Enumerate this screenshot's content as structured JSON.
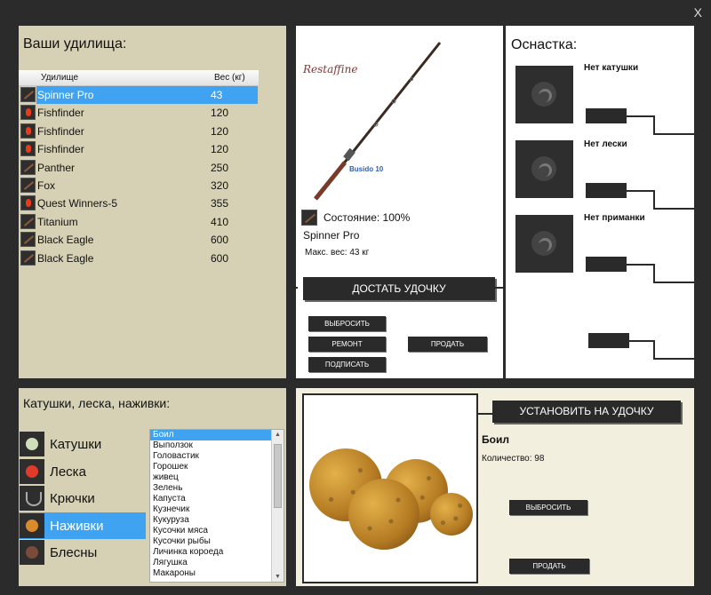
{
  "window": {
    "close_label": "X"
  },
  "rods": {
    "title": "Ваши удилища:",
    "columns": {
      "name": "Удилище",
      "weight": "Вес (кг)"
    },
    "items": [
      {
        "name": "Spinner Pro",
        "weight": "43",
        "icon": "rod-icon",
        "selected": true
      },
      {
        "name": "Fishfinder",
        "weight": "120",
        "icon": "float-icon"
      },
      {
        "name": "Fishfinder",
        "weight": "120",
        "icon": "float-icon"
      },
      {
        "name": "Fishfinder",
        "weight": "120",
        "icon": "float-icon"
      },
      {
        "name": "Panther",
        "weight": "250",
        "icon": "rod-icon"
      },
      {
        "name": "Fox",
        "weight": "320",
        "icon": "rod-icon"
      },
      {
        "name": "Quest Winners-5",
        "weight": "355",
        "icon": "float-icon"
      },
      {
        "name": "Titanium",
        "weight": "410",
        "icon": "rod-icon"
      },
      {
        "name": "Black Eagle",
        "weight": "600",
        "icon": "rod-icon"
      },
      {
        "name": "Black Eagle",
        "weight": "600",
        "icon": "rod-icon"
      }
    ]
  },
  "rod_detail": {
    "brand_logo": "Restaffine",
    "model_label": "Busido 10",
    "state": "Состояние: 100%",
    "name": "Spinner Pro",
    "max_weight": "Макс. вес: 43 кг",
    "take_button": "ДОСТАТЬ УДОЧКУ",
    "discard_button": "ВЫБРОСИТЬ",
    "repair_button": "РЕМОНТ",
    "sign_button": "ПОДПИСАТЬ",
    "sell_button": "ПРОДАТЬ"
  },
  "tackle": {
    "title": "Оснастка:",
    "slots": [
      {
        "label": "Нет катушки"
      },
      {
        "label": "Нет лески"
      },
      {
        "label": "Нет приманки"
      }
    ]
  },
  "categories": {
    "title": "Катушки, леска, наживки:",
    "items": [
      {
        "label": "Катушки",
        "icon": "reel-icon"
      },
      {
        "label": "Леска",
        "icon": "line-spool-icon"
      },
      {
        "label": "Крючки",
        "icon": "hook-icon"
      },
      {
        "label": "Наживки",
        "icon": "bait-icon",
        "selected": true
      },
      {
        "label": "Блесны",
        "icon": "spoon-lure-icon"
      }
    ]
  },
  "bait_list": {
    "items": [
      "Боил",
      "Выползок",
      "Головастик",
      "Горошек",
      "живец",
      "Зелень",
      "Капуста",
      "Кузнечик",
      "Кукуруза",
      "Кусочки мяса",
      "Кусочки рыбы",
      "Личинка короеда",
      "Лягушка",
      "Макароны"
    ],
    "selected_index": 0
  },
  "bait_detail": {
    "install_button": "УСТАНОВИТЬ НА УДОЧКУ",
    "name": "Боил",
    "quantity": "Количество: 98",
    "discard_button": "ВЫБРОСИТЬ",
    "sell_button": "ПРОДАТЬ"
  },
  "colors": {
    "selection": "#3fa3f2",
    "panel_tan": "#d6d1b5",
    "panel_cream": "#f2efde",
    "button_dark": "#2a2a2a",
    "frame": "#2b2b2b"
  }
}
